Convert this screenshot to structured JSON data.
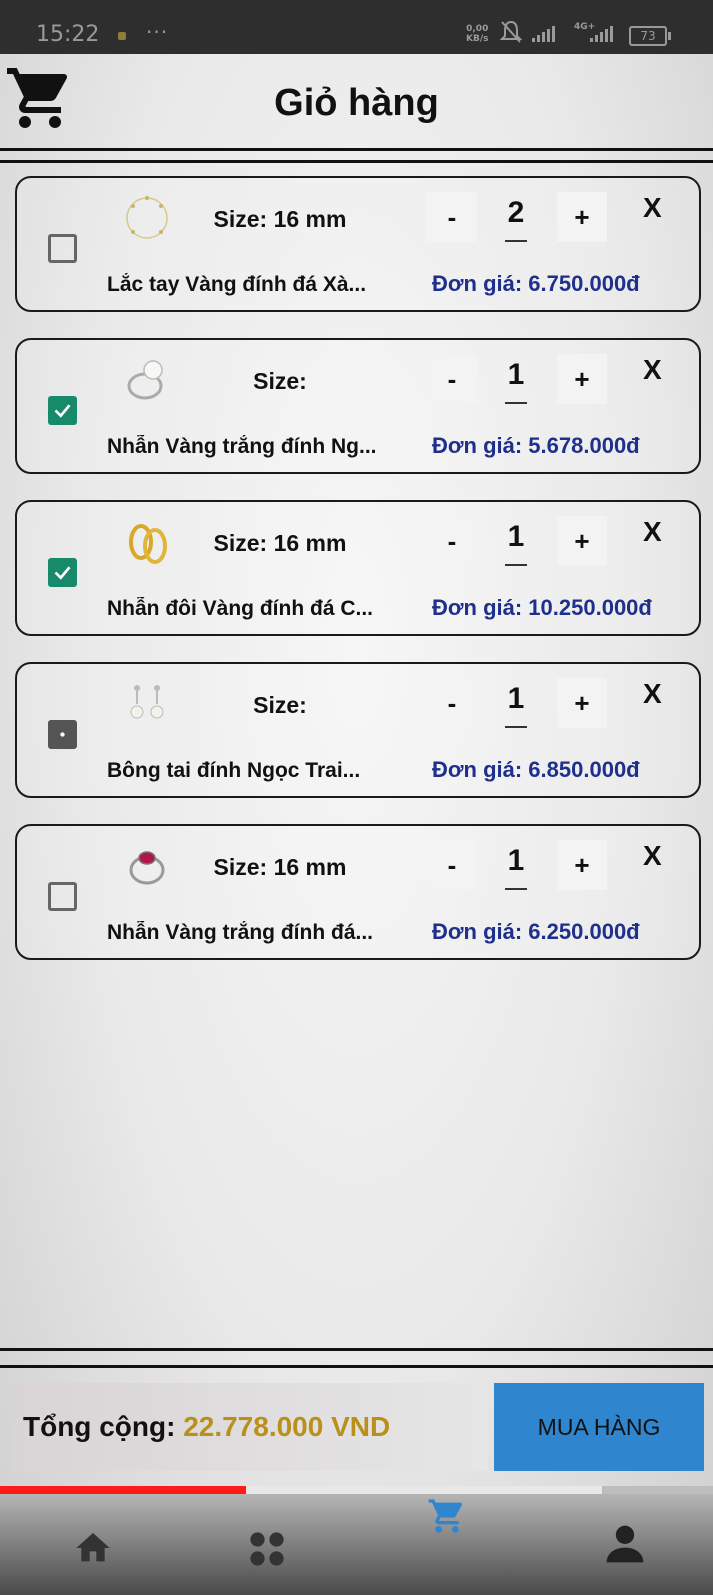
{
  "status_bar": {
    "time": "15:22",
    "more": "···",
    "speed_value": "0,00",
    "speed_unit": "KB/s",
    "network": "4G+",
    "battery": "73"
  },
  "header": {
    "title": "Giỏ hàng",
    "logo_icon": "shopping-cart-icon"
  },
  "cart": {
    "items": [
      {
        "size": "Size: 16 mm",
        "name": "Lắc tay Vàng đính đá Xà...",
        "price": "Đơn giá: 6.750.000đ",
        "quantity": "2",
        "minus": "-",
        "plus": "+",
        "remove": "X",
        "checked": false,
        "image_icon": "bracelet-icon"
      },
      {
        "size": "Size:",
        "name": "Nhẫn Vàng trắng đính Ng...",
        "price": "Đơn giá: 5.678.000đ",
        "quantity": "1",
        "minus": "-",
        "plus": "+",
        "remove": "X",
        "checked": true,
        "image_icon": "pearl-ring-icon"
      },
      {
        "size": "Size: 16 mm",
        "name": "Nhẫn đôi Vàng đính đá C...",
        "price": "Đơn giá: 10.250.000đ",
        "quantity": "1",
        "minus": "-",
        "plus": "+",
        "remove": "X",
        "checked": true,
        "image_icon": "couple-rings-icon"
      },
      {
        "size": "Size:",
        "name": "Bông tai  đính Ngọc Trai...",
        "price": "Đơn giá: 6.850.000đ",
        "quantity": "1",
        "minus": "-",
        "plus": "+",
        "remove": "X",
        "checked": "partial",
        "image_icon": "pearl-earrings-icon"
      },
      {
        "size": "Size: 16 mm",
        "name": "Nhẫn Vàng trắng đính đá...",
        "price": "Đơn giá: 6.250.000đ",
        "quantity": "1",
        "minus": "-",
        "plus": "+",
        "remove": "X",
        "checked": false,
        "image_icon": "ruby-ring-icon"
      }
    ]
  },
  "footer": {
    "total_label": "Tổng cộng: ",
    "total_value": "22.778.000 VND",
    "buy_label": "MUA HÀNG",
    "progress": 0.345
  },
  "nav": {
    "items": [
      "home-icon",
      "grid-icon",
      "cart-icon",
      "user-icon"
    ],
    "active": "cart-icon"
  },
  "colors": {
    "price": "#1f2f8c",
    "total": "#b8901a",
    "buy_button": "#2f86cf",
    "checkbox_checked": "#168a6a",
    "progress": "#ff1a1a",
    "nav_active": "#2f86cf"
  }
}
